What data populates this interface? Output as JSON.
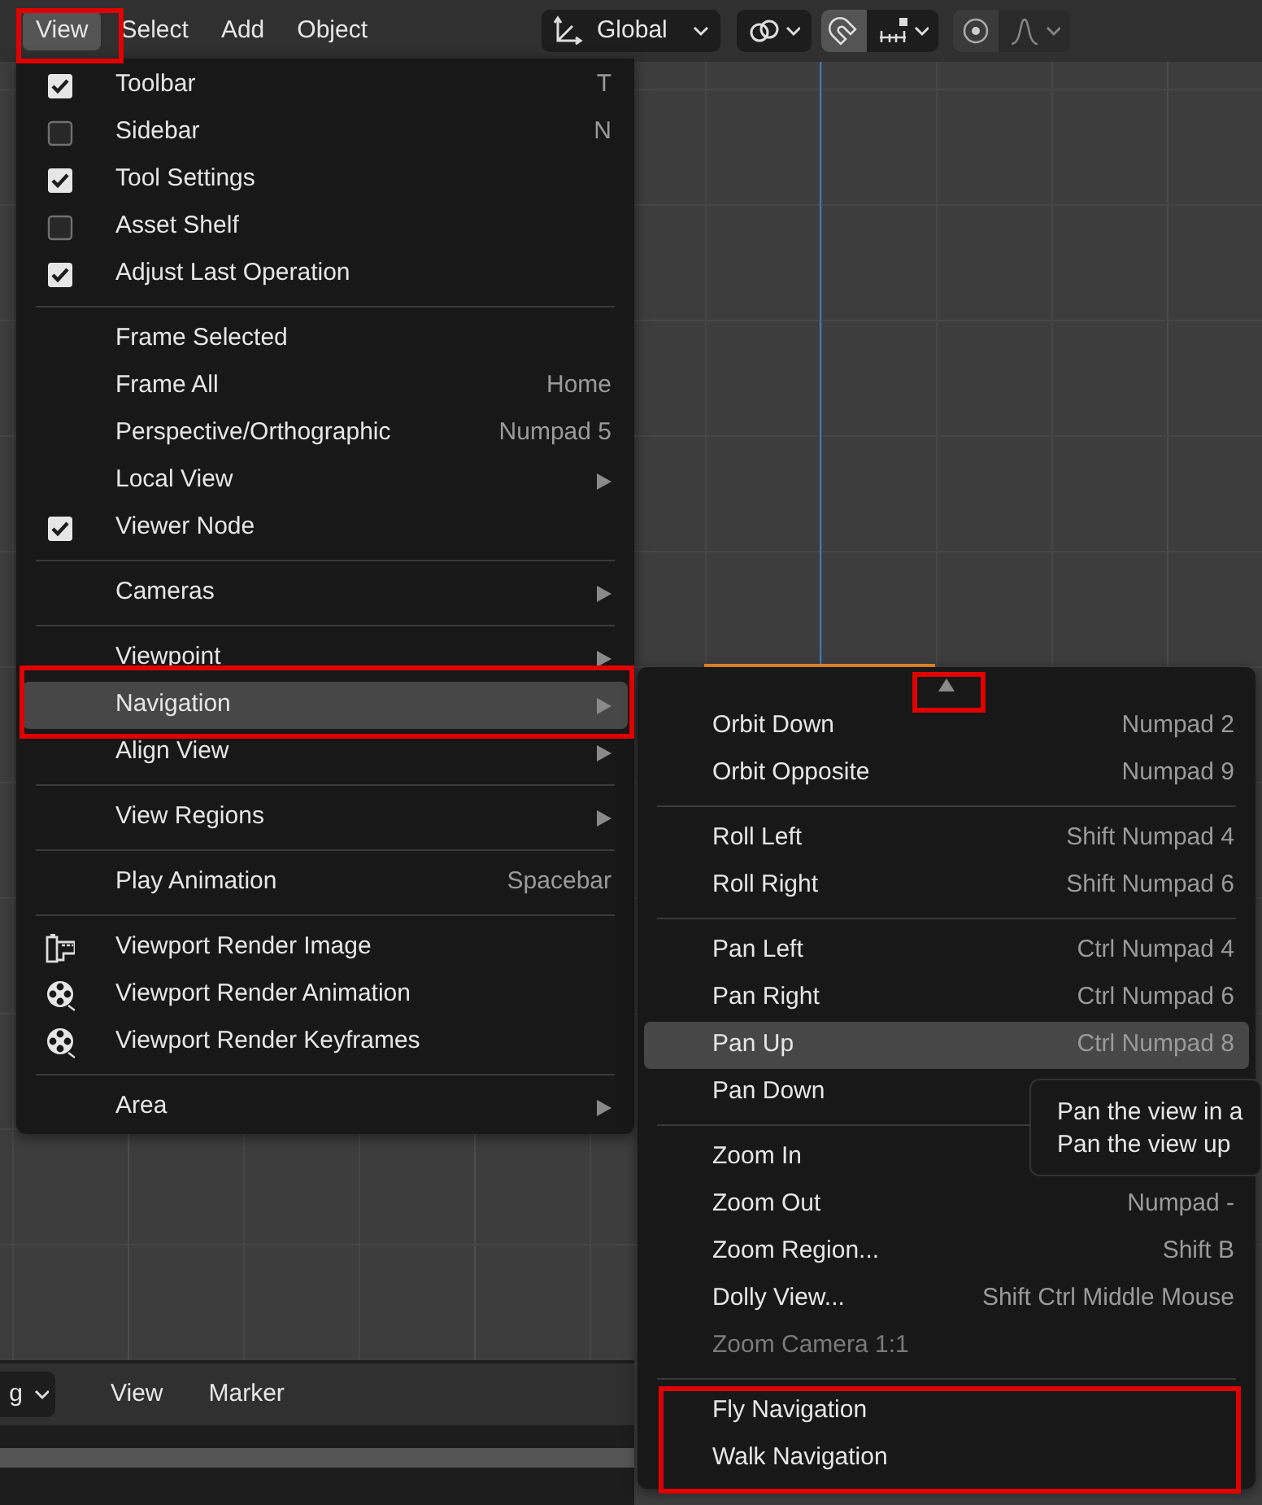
{
  "header": {
    "menus": [
      {
        "label": "View",
        "selected": true
      },
      {
        "label": "Select",
        "selected": false
      },
      {
        "label": "Add",
        "selected": false
      },
      {
        "label": "Object",
        "selected": false
      }
    ],
    "orientation": {
      "label": "Global"
    },
    "snapping": {
      "on": true
    },
    "proportional_editing": {
      "on": false
    }
  },
  "view_menu": {
    "groups": [
      [
        {
          "kind": "check",
          "label": "Toolbar",
          "shortcut": "T",
          "checked": true,
          "selected": false
        },
        {
          "kind": "check",
          "label": "Sidebar",
          "shortcut": "N",
          "checked": false,
          "selected": false
        },
        {
          "kind": "check",
          "label": "Tool Settings",
          "checked": true,
          "selected": false
        },
        {
          "kind": "check",
          "label": "Asset Shelf",
          "checked": false,
          "selected": false
        },
        {
          "kind": "check",
          "label": "Adjust Last Operation",
          "checked": true,
          "selected": false
        }
      ],
      [
        {
          "kind": "plain",
          "label": "Frame Selected",
          "selected": false
        },
        {
          "kind": "plain",
          "label": "Frame All",
          "shortcut": "Home",
          "selected": false
        },
        {
          "kind": "plain",
          "label": "Perspective/Orthographic",
          "shortcut": "Numpad 5",
          "selected": false
        },
        {
          "kind": "submenu",
          "label": "Local View",
          "selected": false
        },
        {
          "kind": "check",
          "label": "Viewer Node",
          "checked": true,
          "selected": false
        }
      ],
      [
        {
          "kind": "submenu",
          "label": "Cameras",
          "selected": false
        }
      ],
      [
        {
          "kind": "submenu",
          "label": "Viewpoint",
          "selected": false
        },
        {
          "kind": "submenu",
          "label": "Navigation",
          "selected": true
        },
        {
          "kind": "submenu",
          "label": "Align View",
          "selected": false
        }
      ],
      [
        {
          "kind": "submenu",
          "label": "View Regions",
          "selected": false
        }
      ],
      [
        {
          "kind": "plain",
          "label": "Play Animation",
          "shortcut": "Spacebar",
          "selected": false
        }
      ],
      [
        {
          "kind": "still",
          "label": "Viewport Render Image",
          "selected": false
        },
        {
          "kind": "reel",
          "label": "Viewport Render Animation",
          "selected": false
        },
        {
          "kind": "reel",
          "label": "Viewport Render Keyframes",
          "selected": false
        }
      ],
      [
        {
          "kind": "submenu",
          "label": "Area",
          "selected": false
        }
      ]
    ]
  },
  "navigation_menu": {
    "groups": [
      [
        {
          "label": "Orbit Down",
          "shortcut": "Numpad 2",
          "selected": false,
          "disabled": false
        },
        {
          "label": "Orbit Opposite",
          "shortcut": "Numpad 9",
          "selected": false,
          "disabled": false
        }
      ],
      [
        {
          "label": "Roll Left",
          "shortcut": "Shift Numpad 4",
          "selected": false,
          "disabled": false
        },
        {
          "label": "Roll Right",
          "shortcut": "Shift Numpad 6",
          "selected": false,
          "disabled": false
        }
      ],
      [
        {
          "label": "Pan Left",
          "shortcut": "Ctrl Numpad 4",
          "selected": false,
          "disabled": false
        },
        {
          "label": "Pan Right",
          "shortcut": "Ctrl Numpad 6",
          "selected": false,
          "disabled": false
        },
        {
          "label": "Pan Up",
          "shortcut": "Ctrl Numpad 8",
          "selected": true,
          "disabled": false
        },
        {
          "label": "Pan Down",
          "selected": false,
          "disabled": false
        }
      ],
      [
        {
          "label": "Zoom In",
          "selected": false,
          "disabled": false
        },
        {
          "label": "Zoom Out",
          "shortcut": "Numpad -",
          "selected": false,
          "disabled": false
        },
        {
          "label": "Zoom Region...",
          "shortcut": "Shift B",
          "selected": false,
          "disabled": false
        },
        {
          "label": "Dolly View...",
          "shortcut": "Shift Ctrl Middle Mouse",
          "selected": false,
          "disabled": false
        },
        {
          "label": "Zoom Camera 1:1",
          "selected": false,
          "disabled": true
        }
      ],
      [
        {
          "label": "Fly Navigation",
          "selected": false,
          "disabled": false
        },
        {
          "label": "Walk Navigation",
          "selected": false,
          "disabled": false
        }
      ]
    ]
  },
  "tooltip": {
    "lines": [
      "Pan the view in a",
      "Pan the view up"
    ]
  },
  "timeline": {
    "mode": "g",
    "menus": [
      "View",
      "Marker"
    ]
  }
}
